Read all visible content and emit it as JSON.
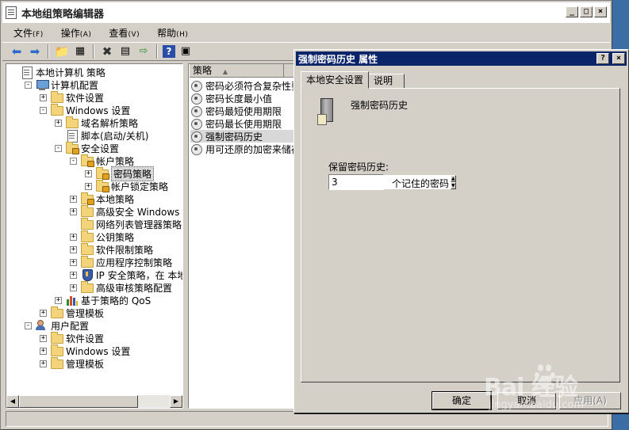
{
  "main_window": {
    "title": "本地组策略编辑器",
    "title_buttons": [
      "_",
      "□",
      "×"
    ]
  },
  "menu": [
    {
      "label": "文件",
      "key": "(F)"
    },
    {
      "label": "操作",
      "key": "(A)"
    },
    {
      "label": "查看",
      "key": "(V)"
    },
    {
      "label": "帮助",
      "key": "(H)"
    }
  ],
  "toolbar": {
    "icons": [
      "back-arrow-icon",
      "forward-arrow-icon",
      "up-folder-icon",
      "show-hide-tree-icon",
      "delete-icon",
      "properties-icon",
      "export-icon",
      "help-icon",
      "console-icon"
    ]
  },
  "tree": [
    {
      "label": "本地计算机 策略",
      "level": 0,
      "expander": "",
      "icon": "doc"
    },
    {
      "label": "计算机配置",
      "level": 1,
      "expander": "-",
      "icon": "computer"
    },
    {
      "label": "软件设置",
      "level": 2,
      "expander": "+",
      "icon": "folder"
    },
    {
      "label": "Windows 设置",
      "level": 2,
      "expander": "-",
      "icon": "folder"
    },
    {
      "label": "域名解析策略",
      "level": 3,
      "expander": "+",
      "icon": "folder"
    },
    {
      "label": "脚本(启动/关机)",
      "level": 3,
      "expander": "",
      "icon": "doc"
    },
    {
      "label": "安全设置",
      "level": 3,
      "expander": "-",
      "icon": "folder-lock"
    },
    {
      "label": "帐户策略",
      "level": 4,
      "expander": "-",
      "icon": "folder-lock"
    },
    {
      "label": "密码策略",
      "level": 5,
      "expander": "+",
      "icon": "folder-lock",
      "selected": true
    },
    {
      "label": "帐户锁定策略",
      "level": 5,
      "expander": "+",
      "icon": "folder-lock"
    },
    {
      "label": "本地策略",
      "level": 4,
      "expander": "+",
      "icon": "folder-lock"
    },
    {
      "label": "高级安全 Windows 防火",
      "level": 4,
      "expander": "+",
      "icon": "folder"
    },
    {
      "label": "网络列表管理器策略",
      "level": 4,
      "expander": "",
      "icon": "folder"
    },
    {
      "label": "公钥策略",
      "level": 4,
      "expander": "+",
      "icon": "folder"
    },
    {
      "label": "软件限制策略",
      "level": 4,
      "expander": "+",
      "icon": "folder"
    },
    {
      "label": "应用程序控制策略",
      "level": 4,
      "expander": "+",
      "icon": "folder"
    },
    {
      "label": "IP 安全策略，在 本地",
      "level": 4,
      "expander": "+",
      "icon": "shield"
    },
    {
      "label": "高级审核策略配置",
      "level": 4,
      "expander": "+",
      "icon": "folder"
    },
    {
      "label": "基于策略的 QoS",
      "level": 3,
      "expander": "+",
      "icon": "barchart"
    },
    {
      "label": "管理模板",
      "level": 2,
      "expander": "+",
      "icon": "folder"
    },
    {
      "label": "用户配置",
      "level": 1,
      "expander": "-",
      "icon": "users"
    },
    {
      "label": "软件设置",
      "level": 2,
      "expander": "+",
      "icon": "folder"
    },
    {
      "label": "Windows 设置",
      "level": 2,
      "expander": "+",
      "icon": "folder"
    },
    {
      "label": "管理模板",
      "level": 2,
      "expander": "+",
      "icon": "folder"
    }
  ],
  "list": {
    "column_header": "策略",
    "rows": [
      {
        "label": "密码必须符合复杂性要"
      },
      {
        "label": "密码长度最小值"
      },
      {
        "label": "密码最短使用期限"
      },
      {
        "label": "密码最长使用期限"
      },
      {
        "label": "强制密码历史",
        "selected": true
      },
      {
        "label": "用可还原的加密来储存"
      }
    ]
  },
  "dialog": {
    "title": "强制密码历史 属性",
    "title_buttons": [
      "?",
      "×"
    ],
    "tabs": [
      {
        "label": "本地安全设置",
        "active": true
      },
      {
        "label": "说明",
        "active": false
      }
    ],
    "policy_name": "强制密码历史",
    "field_label": "保留密码历史:",
    "spin_value": "3",
    "unit_label": "个记住的密码",
    "buttons": {
      "ok": "确定",
      "cancel": "取消",
      "apply": "应用(A)"
    }
  },
  "watermark": {
    "text": "Bai 经验",
    "url": "jingyan.baidu.com"
  }
}
